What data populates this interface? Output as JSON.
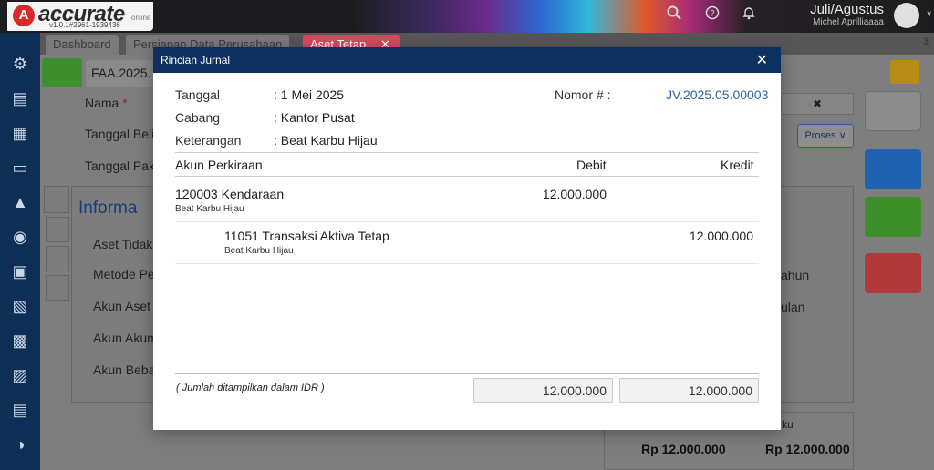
{
  "app": {
    "logo_text": "accurate",
    "logo_sub": "v1.0.1#2961-1939436",
    "logo_online": "online",
    "period": "Juli/Agustus",
    "user": "Michel Aprilliaaaa"
  },
  "tabs": [
    {
      "label": "Dashboard"
    },
    {
      "label": "Persiapan Data Perusahaan"
    },
    {
      "label": "Aset Tetap",
      "close": "✕"
    }
  ],
  "tab_count": "3",
  "background": {
    "doc_tab": "FAA.2025.",
    "nama_label": "Nama",
    "required": "*",
    "tanggal_beli": "Tanggal Beli",
    "tanggal_pakai": "Tanggal Paka",
    "proses_button": "Proses",
    "informasi": "Informa",
    "aset_tidak": "Aset Tidak",
    "metode": "Metode Pe",
    "akun_aset": "Akun Aset",
    "akun_akum": "Akun Akum",
    "akun_beban": "Akun Beba",
    "tahun": "ahun",
    "bulan": "ulan",
    "total_left": "Rp 12.000.000",
    "total_right": "Rp 12.000.000",
    "ku": "ku"
  },
  "modal": {
    "title": "Rincian Jurnal",
    "close": "✕",
    "fields": {
      "tanggal_label": "Tanggal",
      "tanggal_value": ": 1 Mei 2025",
      "cabang_label": "Cabang",
      "cabang_value": ": Kantor Pusat",
      "keterangan_label": "Keterangan",
      "keterangan_value": ": Beat Karbu Hijau",
      "nomor_label": "Nomor # :",
      "nomor_value": "JV.2025.05.00003"
    },
    "columns": {
      "akun": "Akun Perkiraan",
      "debit": "Debit",
      "kredit": "Kredit"
    },
    "rows": [
      {
        "account": "120003 Kendaraan",
        "note": "Beat Karbu Hijau",
        "debit": "12.000.000",
        "kredit": ""
      },
      {
        "account": "11051 Transaksi Aktiva Tetap",
        "note": "Beat Karbu Hijau",
        "debit": "",
        "kredit": "12.000.000"
      }
    ],
    "footer_note": "( Jumlah ditampilkan dalam IDR )",
    "total_debit": "12.000.000",
    "total_kredit": "12.000.000"
  },
  "colors": {
    "header_navy": "#0c3160",
    "link_blue": "#2c64a6",
    "active_tab": "#d9495f"
  }
}
